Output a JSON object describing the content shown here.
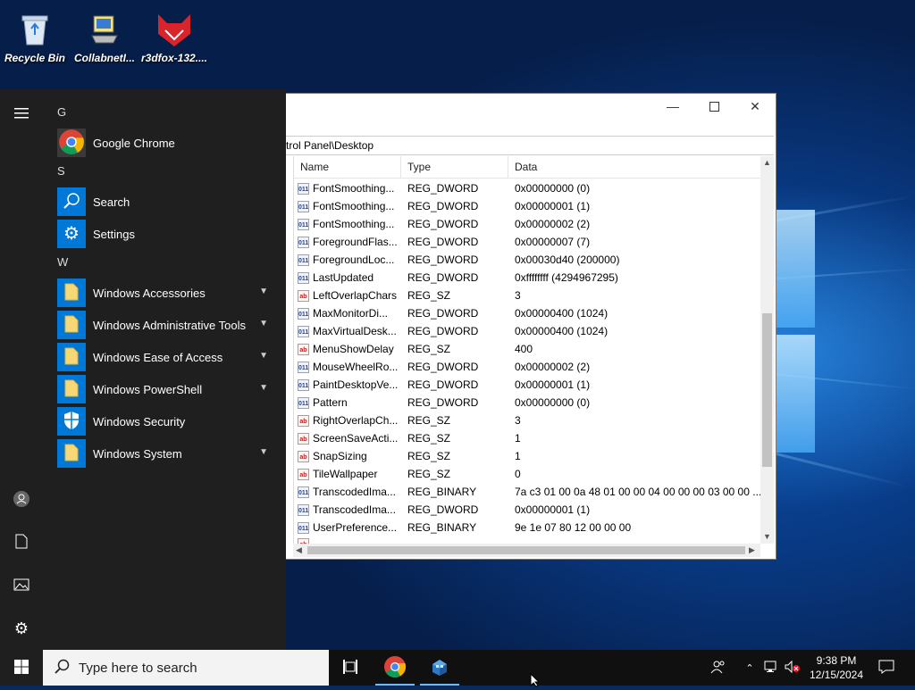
{
  "desktop": {
    "icons": [
      {
        "label": "Recycle Bin",
        "icon": "recycle-bin-icon"
      },
      {
        "label": "CollabnetI...",
        "icon": "collabnet-icon"
      },
      {
        "label": "r3dfox-132....",
        "icon": "r3dfox-icon"
      }
    ]
  },
  "start_menu": {
    "groups": [
      {
        "letter": "G",
        "apps": [
          {
            "label": "Google Chrome",
            "icon": "chrome-icon",
            "expandable": false
          }
        ]
      },
      {
        "letter": "S",
        "apps": [
          {
            "label": "Search",
            "icon": "search-icon",
            "expandable": false
          },
          {
            "label": "Settings",
            "icon": "gear-icon",
            "expandable": false
          }
        ]
      },
      {
        "letter": "W",
        "apps": [
          {
            "label": "Windows Accessories",
            "icon": "folder-icon",
            "expandable": true
          },
          {
            "label": "Windows Administrative Tools",
            "icon": "folder-icon",
            "expandable": true
          },
          {
            "label": "Windows Ease of Access",
            "icon": "folder-icon",
            "expandable": true
          },
          {
            "label": "Windows PowerShell",
            "icon": "folder-icon",
            "expandable": true
          },
          {
            "label": "Windows Security",
            "icon": "shield-icon",
            "expandable": false
          },
          {
            "label": "Windows System",
            "icon": "folder-icon",
            "expandable": true
          }
        ]
      }
    ],
    "rail": [
      "hamburger-icon",
      "user-icon",
      "document-icon",
      "pictures-icon",
      "gear-icon"
    ]
  },
  "registry": {
    "address": "trol Panel\\Desktop",
    "columns": [
      "Name",
      "Type",
      "Data"
    ],
    "rows": [
      {
        "name": "FontSmoothing...",
        "type": "REG_DWORD",
        "data": "0x00000000 (0)",
        "kind": "num"
      },
      {
        "name": "FontSmoothing...",
        "type": "REG_DWORD",
        "data": "0x00000001 (1)",
        "kind": "num"
      },
      {
        "name": "FontSmoothing...",
        "type": "REG_DWORD",
        "data": "0x00000002 (2)",
        "kind": "num"
      },
      {
        "name": "ForegroundFlas...",
        "type": "REG_DWORD",
        "data": "0x00000007 (7)",
        "kind": "num"
      },
      {
        "name": "ForegroundLoc...",
        "type": "REG_DWORD",
        "data": "0x00030d40 (200000)",
        "kind": "num"
      },
      {
        "name": "LastUpdated",
        "type": "REG_DWORD",
        "data": "0xffffffff (4294967295)",
        "kind": "num"
      },
      {
        "name": "LeftOverlapChars",
        "type": "REG_SZ",
        "data": "3",
        "kind": "str"
      },
      {
        "name": "MaxMonitorDi...",
        "type": "REG_DWORD",
        "data": "0x00000400 (1024)",
        "kind": "num"
      },
      {
        "name": "MaxVirtualDesk...",
        "type": "REG_DWORD",
        "data": "0x00000400 (1024)",
        "kind": "num"
      },
      {
        "name": "MenuShowDelay",
        "type": "REG_SZ",
        "data": "400",
        "kind": "str"
      },
      {
        "name": "MouseWheelRo...",
        "type": "REG_DWORD",
        "data": "0x00000002 (2)",
        "kind": "num"
      },
      {
        "name": "PaintDesktopVe...",
        "type": "REG_DWORD",
        "data": "0x00000001 (1)",
        "kind": "num"
      },
      {
        "name": "Pattern",
        "type": "REG_DWORD",
        "data": "0x00000000 (0)",
        "kind": "num"
      },
      {
        "name": "RightOverlapCh...",
        "type": "REG_SZ",
        "data": "3",
        "kind": "str"
      },
      {
        "name": "ScreenSaveActi...",
        "type": "REG_SZ",
        "data": "1",
        "kind": "str"
      },
      {
        "name": "SnapSizing",
        "type": "REG_SZ",
        "data": "1",
        "kind": "str"
      },
      {
        "name": "TileWallpaper",
        "type": "REG_SZ",
        "data": "0",
        "kind": "str"
      },
      {
        "name": "TranscodedIma...",
        "type": "REG_BINARY",
        "data": "7a c3 01 00 0a 48 01 00 00 04 00 00 00 03 00 00 ...",
        "kind": "num"
      },
      {
        "name": "TranscodedIma...",
        "type": "REG_DWORD",
        "data": "0x00000001 (1)",
        "kind": "num"
      },
      {
        "name": "UserPreference...",
        "type": "REG_BINARY",
        "data": "9e 1e 07 80 12 00 00 00",
        "kind": "num"
      }
    ]
  },
  "taskbar": {
    "search_placeholder": "Type here to search",
    "time": "9:38 PM",
    "date": "12/15/2024"
  }
}
